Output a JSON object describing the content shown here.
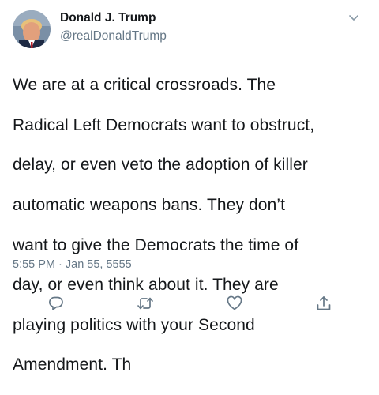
{
  "author": {
    "display_name": "Donald J. Trump",
    "handle": "@realDonaldTrump",
    "avatar_icon": "profile-photo"
  },
  "tweet": {
    "text_lines": [
      "We are at a critical crossroads. The",
      "Radical Left Democrats want to obstruct,",
      "delay, or even veto the adoption of killer",
      "automatic weapons bans. They don’t",
      "want to give the Democrats the time of",
      "day, or even think about it. They are",
      "playing politics with your Second",
      "Amendment. Th"
    ],
    "timestamp": "5:55 PM · Jan 55, 5555"
  },
  "actions": {
    "reply_icon": "reply-icon",
    "retweet_icon": "retweet-icon",
    "like_icon": "like-icon",
    "share_icon": "share-icon"
  },
  "colors": {
    "text": "#14171a",
    "secondary_text": "#657786",
    "divider": "#e1e8ed",
    "icon": "#657786"
  }
}
